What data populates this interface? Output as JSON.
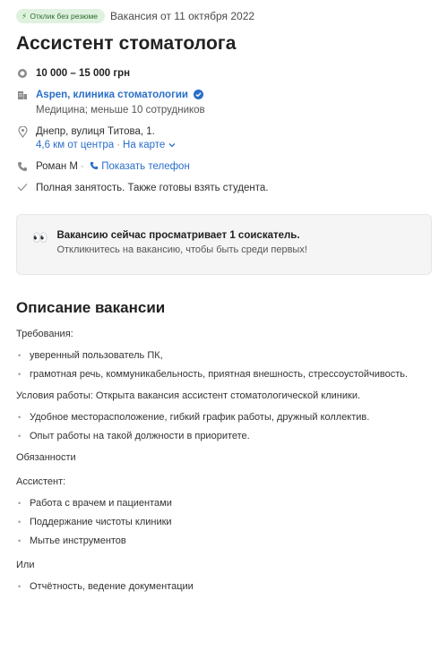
{
  "header": {
    "badge_label": "Отклик без резюме",
    "date": "Вакансия от 11 октября 2022",
    "title": "Ассистент стоматолога"
  },
  "details": {
    "salary": "10 000 – 15 000 грн",
    "company_name": "Aspen, клиника стоматологии",
    "company_info": "Медицина; меньше 10 сотрудников",
    "address": "Днепр, вулиця Титова, 1.",
    "distance": "4,6 км от центра",
    "map_link": "На карте",
    "contact_name": "Роман М",
    "show_phone": "Показать телефон",
    "employment": "Полная занятость. Также готовы взять студента."
  },
  "notice": {
    "title": "Вакансию сейчас просматривает 1 соискатель.",
    "subtitle": "Откликнитесь на вакансию, чтобы быть среди первых!"
  },
  "description": {
    "heading": "Описание вакансии",
    "requirements_label": "Требования:",
    "requirements": [
      "уверенный пользователь ПК,",
      "грамотная речь, коммуникабельность, приятная внешность, стрессоустойчивость."
    ],
    "conditions_label": "Условия работы: Открыта вакансия ассистент стоматологической клиники.",
    "conditions": [
      "Удобное месторасположение, гибкий график работы, дружный коллектив.",
      "Опыт работы на такой должности в приоритете."
    ],
    "duties_label": "Обязанности",
    "assistant_label": "Ассистент:",
    "assistant_duties": [
      "Работа с врачем и пациентами",
      "Поддержание чистоты клиники",
      "Мытье инструментов"
    ],
    "or_label": "Или",
    "other_duties": [
      "Отчётность, ведение документации"
    ]
  },
  "icons": {
    "badge": "lightning-icon",
    "salary": "coin-icon",
    "company": "building-icon",
    "verified": "verified-check-icon",
    "location": "location-pin-icon",
    "phone": "phone-icon",
    "employment": "checkmark-icon",
    "eyes": "eyes-icon"
  },
  "colors": {
    "link": "#2a6fc9",
    "badge_bg": "#dff2df",
    "badge_text": "#2f6b2f",
    "notice_bg": "#f5f5f5"
  }
}
